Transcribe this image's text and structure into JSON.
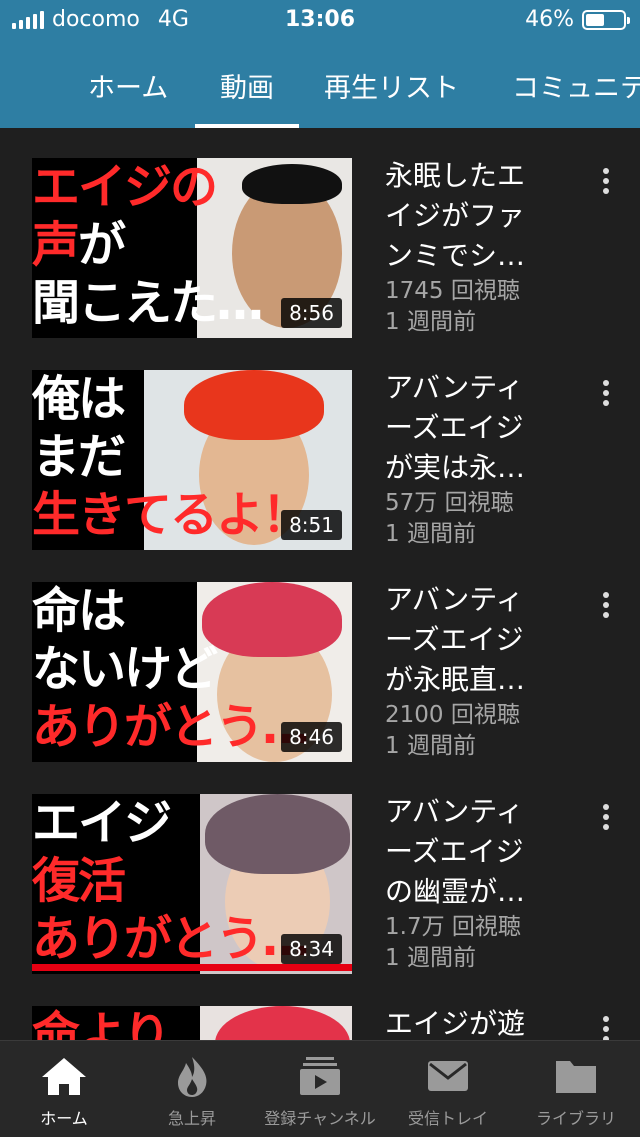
{
  "status": {
    "carrier": "docomo",
    "network": "4G",
    "time": "13:06",
    "battery": "46%"
  },
  "tabs": [
    "ホーム",
    "動画",
    "再生リスト",
    "コミュニテ"
  ],
  "active_tab": 1,
  "videos": [
    {
      "title_lines": [
        "永眠したエ",
        "イジがファ",
        "ンミでシ…"
      ],
      "views": "1745 回視聴",
      "age": "1 週間前",
      "duration": "8:56",
      "thumb_lines": [
        {
          "text": "エイジの",
          "color": "red"
        },
        {
          "text": "声が",
          "color": "mixed"
        },
        {
          "text": "聞こえた…",
          "color": "white"
        }
      ]
    },
    {
      "title_lines": [
        "アバンティ",
        "ーズエイジ",
        "が実は永…"
      ],
      "views": "57万 回視聴",
      "age": "1 週間前",
      "duration": "8:51",
      "thumb_lines": [
        {
          "text": "俺は",
          "color": "white"
        },
        {
          "text": "まだ",
          "color": "white"
        },
        {
          "text": "生きてるよ！",
          "color": "red"
        }
      ]
    },
    {
      "title_lines": [
        "アバンティ",
        "ーズエイジ",
        "が永眠直…"
      ],
      "views": "2100 回視聴",
      "age": "1 週間前",
      "duration": "8:46",
      "thumb_lines": [
        {
          "text": "命は",
          "color": "white"
        },
        {
          "text": "ないけど",
          "color": "white"
        },
        {
          "text": "ありがとう…",
          "color": "red"
        }
      ]
    },
    {
      "title_lines": [
        "アバンティ",
        "ーズエイジ",
        "の幽霊が…"
      ],
      "views": "1.7万 回視聴",
      "age": "1 週間前",
      "duration": "8:34",
      "thumb_lines": [
        {
          "text": "エイジ",
          "color": "white"
        },
        {
          "text": "復活",
          "color": "red"
        },
        {
          "text": "ありがとう…",
          "color": "red"
        }
      ]
    },
    {
      "title_lines": [
        "エイジが遊"
      ],
      "views": "",
      "age": "",
      "duration": "",
      "thumb_lines": [
        {
          "text": "命より",
          "color": "red"
        }
      ]
    }
  ],
  "bottom_nav": [
    {
      "label": "ホーム",
      "icon": "home-icon",
      "active": true
    },
    {
      "label": "急上昇",
      "icon": "flame-icon",
      "active": false
    },
    {
      "label": "登録チャンネル",
      "icon": "subscriptions-icon",
      "active": false
    },
    {
      "label": "受信トレイ",
      "icon": "mail-icon",
      "active": false
    },
    {
      "label": "ライブラリ",
      "icon": "folder-icon",
      "active": false
    }
  ]
}
